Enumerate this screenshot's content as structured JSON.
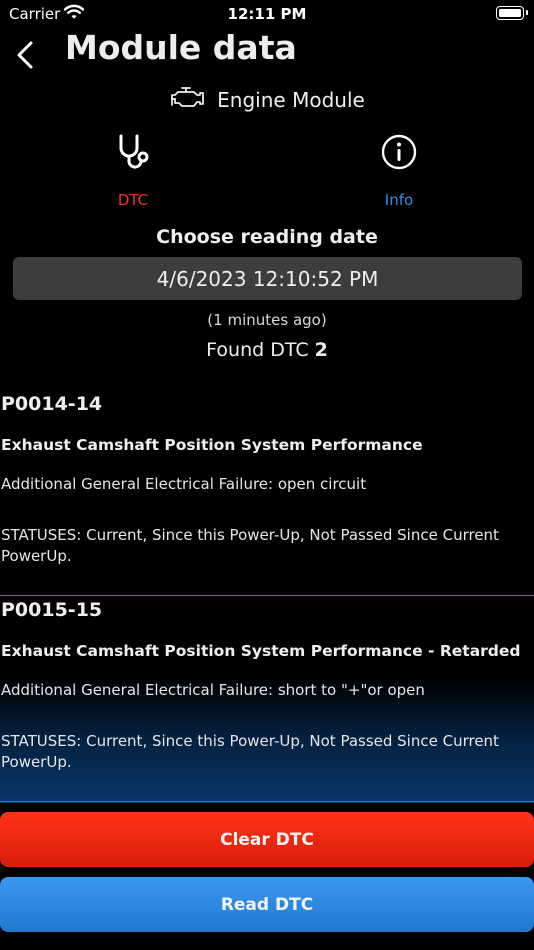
{
  "status_bar": {
    "carrier": "Carrier",
    "time": "12:11 PM"
  },
  "header": {
    "title": "Module data"
  },
  "module": {
    "name": "Engine Module",
    "icon": "engine-icon"
  },
  "tabs": [
    {
      "label": "DTC",
      "icon": "stethoscope-icon",
      "color": "#ff2d20"
    },
    {
      "label": "Info",
      "icon": "info-icon",
      "color": "#2e8fe6"
    }
  ],
  "reading": {
    "choose_label": "Choose reading date",
    "date": "4/6/2023 12:10:52 PM",
    "ago": "(1 minutes ago)",
    "found_label": "Found DTC",
    "found_count": "2"
  },
  "dtcs": [
    {
      "code": "P0014-14",
      "description": "Exhaust Camshaft Position System Performance",
      "additional": "Additional General Electrical Failure: open circuit",
      "statuses": "STATUSES: Current, Since this Power-Up, Not Passed Since Current PowerUp."
    },
    {
      "code": "P0015-15",
      "description": "Exhaust Camshaft Position System Performance - Retarded",
      "additional": "Additional General Electrical Failure: short to \"+\"or open",
      "statuses": "STATUSES: Current, Since this Power-Up, Not Passed Since Current PowerUp."
    }
  ],
  "actions": {
    "clear_label": "Clear DTC",
    "read_label": "Read DTC"
  },
  "colors": {
    "accent_blue": "#2e8fe6",
    "accent_red": "#ff2d20",
    "background": "#000000"
  }
}
